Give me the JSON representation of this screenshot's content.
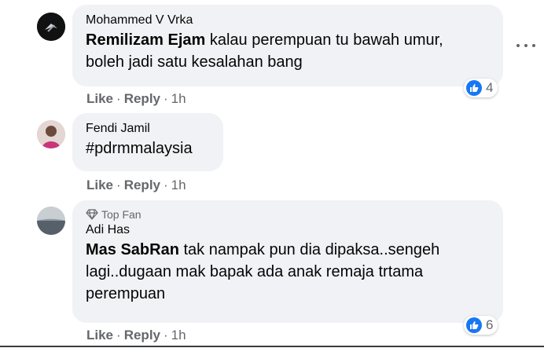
{
  "comments": [
    {
      "author": "Mohammed V Vrka",
      "mention": "Remilizam Ejam",
      "text_line1": " kalau perempuan tu bawah umur,",
      "text_line2": "boleh jadi satu kesalahan bang",
      "like_label": "Like",
      "reply_label": "Reply",
      "time": "1h",
      "reaction_count": "4"
    },
    {
      "author": "Fendi Jamil",
      "text": "#pdrmmalaysia",
      "like_label": "Like",
      "reply_label": "Reply",
      "time": "1h"
    },
    {
      "badge": "Top Fan",
      "author": "Adi Has",
      "mention": "Mas SabRan",
      "text_line1": " tak nampak pun dia dipaksa..sengeh",
      "text_line2": "lagi..dugaan mak bapak ada anak remaja trtama",
      "text_line3": "perempuan",
      "like_label": "Like",
      "reply_label": "Reply",
      "time": "1h",
      "reaction_count": "6"
    }
  ],
  "separator": "·",
  "icons": {
    "more": "more-horizontal-icon",
    "like_reaction": "thumbs-up-icon",
    "top_fan": "diamond-icon"
  },
  "colors": {
    "bubble": "#f0f2f5",
    "meta": "#65676b",
    "like_blue": "#1877f2"
  }
}
